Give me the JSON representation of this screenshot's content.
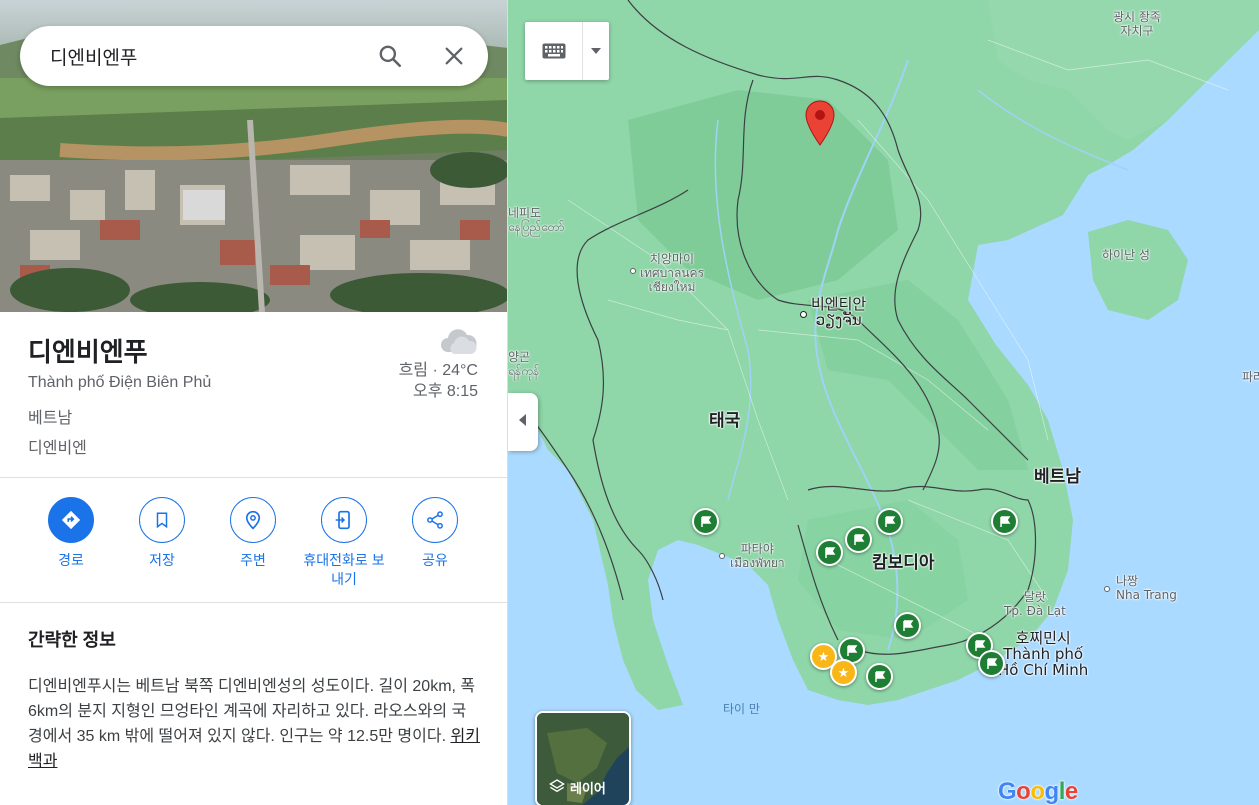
{
  "search": {
    "value": "디엔비엔푸"
  },
  "place": {
    "title": "디엔비엔푸",
    "subtitle_native": "Thành phố Điện Biên Phủ",
    "country": "베트남",
    "province": "디엔비엔",
    "weather": {
      "condition": "흐림 · 24°C",
      "time": "오후 8:15",
      "icon": "cloud-icon"
    }
  },
  "actions": [
    {
      "label": "경로",
      "icon": "directions-icon"
    },
    {
      "label": "저장",
      "icon": "bookmark-icon"
    },
    {
      "label": "주변",
      "icon": "nearby-icon"
    },
    {
      "label": "휴대전화로 보\n내기",
      "icon": "send-to-phone-icon"
    },
    {
      "label": "공유",
      "icon": "share-icon"
    }
  ],
  "about": {
    "title": "간략한 정보",
    "body": "디엔비엔푸시는 베트남 북쪽 디엔비엔성의 성도이다. 길이 20km, 폭 6km의 분지 지형인 므엉타인 계곡에 자리하고 있다. 라오스와의 국경에서 35 km 밖에 떨어져 있지 않다. 인구는 약 12.5만 명이다.",
    "link": "위키백과"
  },
  "map": {
    "labels": {
      "guangxi": "광시 좡족\n자치구",
      "naypyidaw": "네피도\nနေပြည်တော်",
      "chiangmai": "치앙마이\nเทศบาลนคร\nเชียงใหม่",
      "vientiane": "비엔티안\nວຽງຈັນ",
      "yangon": "양곤\nရန်ကုန်",
      "thailand": "태국",
      "hainan": "하이난 성",
      "vietnam": "베트남",
      "pattaya": "파타야\nเมืองพัทยา",
      "cambodia": "캄보디아",
      "dalat": "달랏\nTp. Đà Lạt",
      "nhatrang": "나짱\nNha Trang",
      "hcmc": "호찌민시\nThành phố\nHồ Chí Minh",
      "gulf": "타이 만",
      "edge": "파라"
    },
    "layer_label": "레이어",
    "logo": "Google",
    "colors": {
      "sea": "#aadaff",
      "land": "#8fd6a8",
      "pin_green": "#1e7e34",
      "pin_star": "#f9b619",
      "marker_red": "#ea4335"
    }
  }
}
